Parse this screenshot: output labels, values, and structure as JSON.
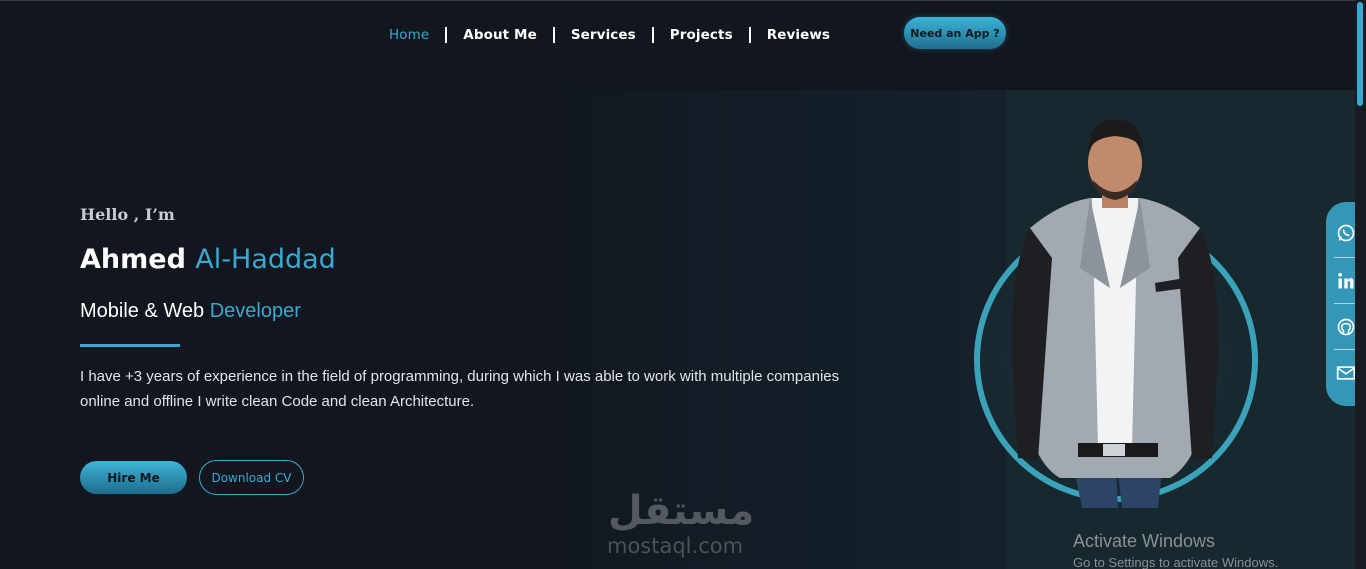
{
  "nav": {
    "links": [
      {
        "label": "Home",
        "active": true
      },
      {
        "label": "About Me",
        "active": false
      },
      {
        "label": "Services",
        "active": false
      },
      {
        "label": "Projects",
        "active": false
      },
      {
        "label": "Reviews",
        "active": false
      }
    ],
    "cta_label": "Need an App ?"
  },
  "hero": {
    "greeting": "Hello , I’m",
    "first_name": "Ahmed",
    "last_name": "Al-Haddad",
    "role_prefix": "Mobile & Web",
    "role_highlight": "Developer",
    "description": "I have +3 years of experience in the field of programming, during which I was able to work with multiple companies online and offline I write clean Code and clean Architecture.",
    "hire_label": "Hire Me",
    "cv_label": "Download CV"
  },
  "social": {
    "items": [
      {
        "icon": "whatsapp-icon"
      },
      {
        "icon": "linkedin-icon"
      },
      {
        "icon": "github-icon"
      },
      {
        "icon": "mail-icon"
      }
    ]
  },
  "watermark": {
    "arabic": "مستقل",
    "latin": "mostaql.com"
  },
  "windows": {
    "title": "Activate Windows",
    "subtitle": "Go to Settings to activate Windows."
  },
  "colors": {
    "accent": "#39a9d2",
    "background": "#12161e",
    "social_bar": "#3497b8",
    "ring": "#3aa3b9"
  }
}
